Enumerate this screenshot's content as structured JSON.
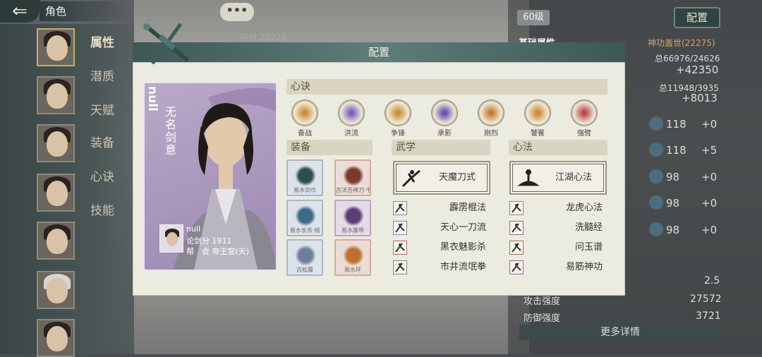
{
  "topbar": {
    "back_icon": "back-arrow-icon",
    "title": "角色",
    "chat_dots": "•••",
    "level": "60级",
    "config_button": "配置",
    "score_label": "评分 22275"
  },
  "sidebar": {
    "items": [
      {
        "label": "属性"
      },
      {
        "label": "潜质"
      },
      {
        "label": "天赋"
      },
      {
        "label": "装备"
      },
      {
        "label": "心诀"
      },
      {
        "label": "技能"
      }
    ]
  },
  "stats_background": {
    "base_attr_label": "基础属性",
    "skill_name": "神功盖世(22275)",
    "total1": "总66976/24626",
    "total1_bonus": "+42350",
    "total2": "总11948/3935",
    "total2_bonus": "+8013",
    "rows": [
      {
        "value": "118",
        "bonus": "+0"
      },
      {
        "value": "118",
        "bonus": "+5"
      },
      {
        "value": "98",
        "bonus": "+0"
      },
      {
        "value": "98",
        "bonus": "+0"
      },
      {
        "value": "98",
        "bonus": "+0"
      }
    ],
    "crit_value": "2.5",
    "attack_label": "攻击强度",
    "attack_value": "27572",
    "defense_label": "防御强度",
    "defense_value": "3721",
    "more_details": "更多详情"
  },
  "dialog": {
    "title": "配置",
    "character": {
      "name": "null",
      "title": "无名剑意",
      "info_name": "null",
      "score": "论剑分 1911",
      "guild": "帮　会 帝王宫(天)"
    },
    "xinjue": {
      "header": "心诀",
      "skills": [
        {
          "label": "奋战",
          "color": "#c98d3c"
        },
        {
          "label": "洪流",
          "color": "#7b5fb5"
        },
        {
          "label": "争锋",
          "color": "#c9913a"
        },
        {
          "label": "承影",
          "color": "#6b4fb0"
        },
        {
          "label": "刚烈",
          "color": "#c57d35"
        },
        {
          "label": "饕餮",
          "color": "#c98d3c"
        },
        {
          "label": "强臂",
          "color": "#b84a4a"
        }
      ]
    },
    "equipment": {
      "header": "装备",
      "items": [
        {
          "name": "易水剑巾",
          "tone": "blue"
        },
        {
          "name": "古法吾神刀·千钧",
          "tone": "pink"
        },
        {
          "name": "易水长衣·绢",
          "tone": "blue"
        },
        {
          "name": "易水腰带",
          "tone": "purple"
        },
        {
          "name": "古松履",
          "tone": "blue"
        },
        {
          "name": "易水环",
          "tone": "pink"
        }
      ]
    },
    "wuxue": {
      "header": "武学",
      "main": "天魔刀式",
      "list": [
        {
          "name": "霹雳棍法",
          "tone": "b"
        },
        {
          "name": "天心一刀流",
          "tone": "b"
        },
        {
          "name": "黑衣魅影杀",
          "tone": "r"
        },
        {
          "name": "市井流氓拳",
          "tone": "g"
        }
      ]
    },
    "xinfa": {
      "header": "心法",
      "main": "江湖心法",
      "list": [
        {
          "name": "龙虎心法",
          "tone": "g"
        },
        {
          "name": "洗髓经",
          "tone": "p"
        },
        {
          "name": "问玉谱",
          "tone": "r"
        },
        {
          "name": "易筋神功",
          "tone": "p"
        }
      ]
    }
  }
}
